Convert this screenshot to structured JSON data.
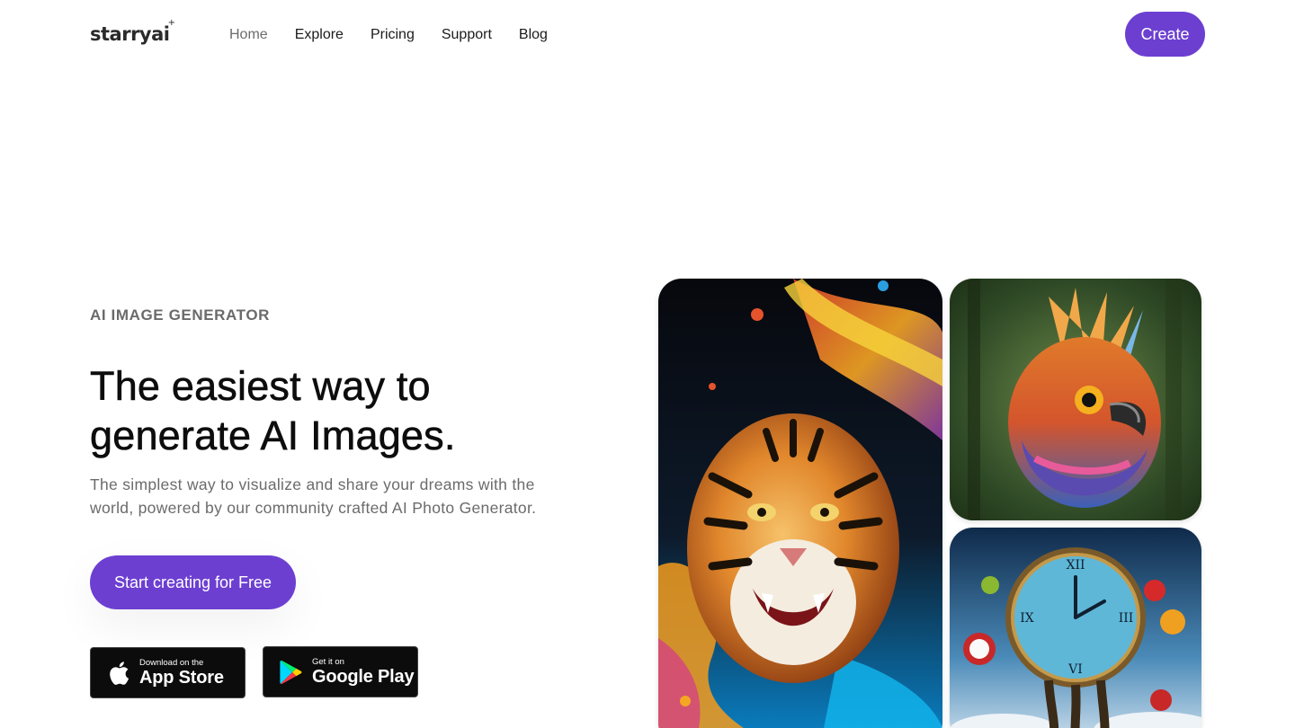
{
  "header": {
    "logo": "starryai",
    "nav": [
      {
        "label": "Home",
        "active": true
      },
      {
        "label": "Explore",
        "active": false
      },
      {
        "label": "Pricing",
        "active": false
      },
      {
        "label": "Support",
        "active": false
      },
      {
        "label": "Blog",
        "active": false
      }
    ],
    "create_label": "Create"
  },
  "hero": {
    "eyebrow": "AI IMAGE GENERATOR",
    "headline_line1": "The easiest way to",
    "headline_line2": "generate AI Images.",
    "subtitle_line1": "The simplest way to visualize and share your dreams with the",
    "subtitle_line2": "world, powered by our community crafted AI Photo Generator.",
    "cta_label": "Start creating for Free"
  },
  "stores": {
    "apple": {
      "small": "Download on the",
      "big": "App Store"
    },
    "google": {
      "small": "Get it on",
      "big": "Google Play"
    }
  },
  "gallery": [
    {
      "subject": "tiger-painting"
    },
    {
      "subject": "colorful-bird"
    },
    {
      "subject": "melting-clock"
    }
  ],
  "colors": {
    "accent": "#6c3fd1",
    "text": "#0d0d0d",
    "muted": "#6b6b6b"
  }
}
